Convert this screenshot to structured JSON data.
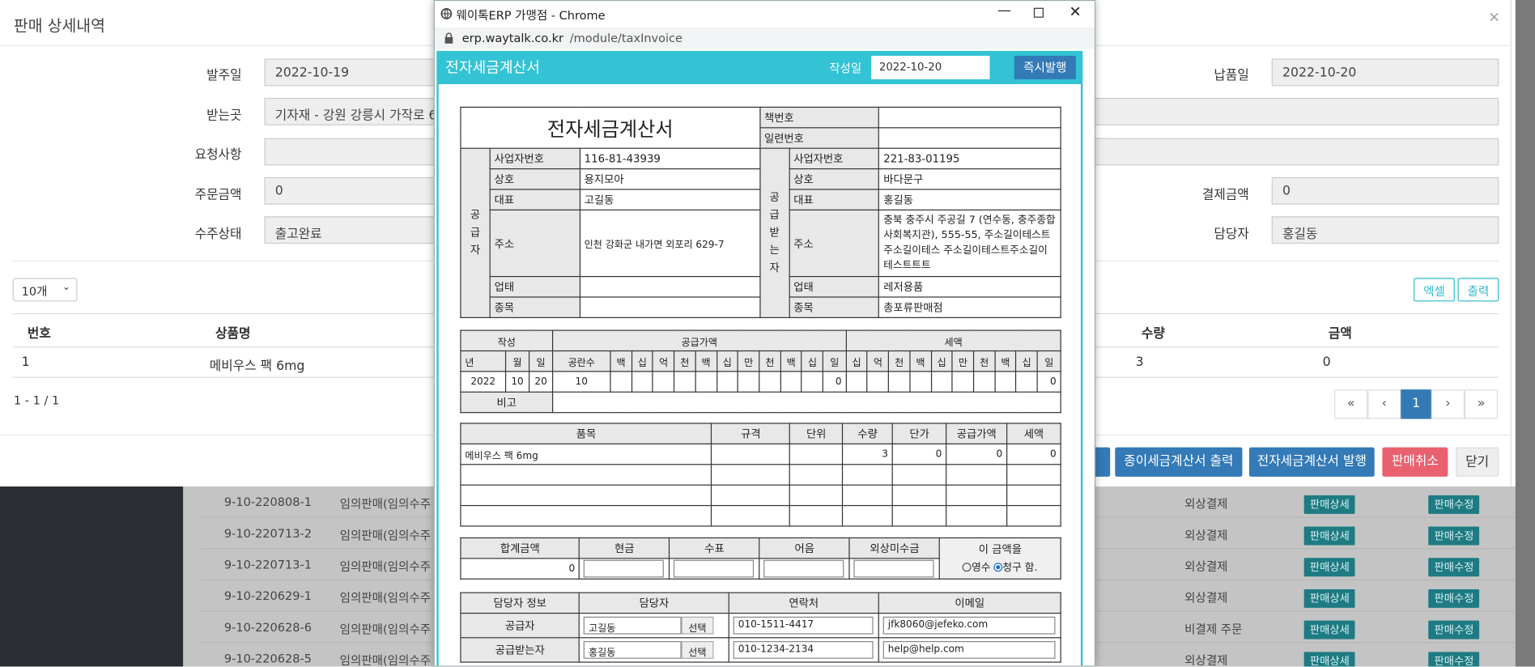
{
  "bg_rows": [
    {
      "id": "9-10-220808-1",
      "name": "임의판매(임의수주",
      "pay": "외상결제"
    },
    {
      "id": "9-10-220713-2",
      "name": "임의판매(임의수주",
      "pay": "외상결제"
    },
    {
      "id": "9-10-220713-1",
      "name": "임의판매(임의수주",
      "pay": "외상결제"
    },
    {
      "id": "9-10-220629-1",
      "name": "임의판매(임의수주",
      "pay": "외상결제"
    },
    {
      "id": "9-10-220628-6",
      "name": "임의판매(임의수주",
      "pay": "비결제 주문"
    },
    {
      "id": "9-10-220628-5",
      "name": "임의판매(임의수주",
      "pay": "외상결제"
    }
  ],
  "bg_btn_detail": "판매상세",
  "bg_btn_edit": "판매수정",
  "modal": {
    "title": "판매 상세내역",
    "close": "×",
    "order_date_label": "발주일",
    "order_date": "2022-10-19",
    "delivery_date_label": "납품일",
    "delivery_date": "2022-10-20",
    "ship_to_label": "받는곳",
    "ship_to": "기자재 - 강원 강릉시 가작로 6 (",
    "request_label": "요청사항",
    "order_amount_label": "주문금액",
    "order_amount": "0",
    "pay_amount_label": "결제금액",
    "pay_amount": "0",
    "status_label": "수주상태",
    "status": "출고완료",
    "manager_label": "담당자",
    "manager": "홍길동",
    "page_size": "10개",
    "excel": "엑셀",
    "print": "출력",
    "col_no": "번호",
    "col_product": "상품명",
    "col_qty": "수량",
    "col_amount": "금액",
    "row_no": "1",
    "row_product": "메비우스 팩 6mg",
    "row_qty": "3",
    "row_amount": "0",
    "range": "1 - 1 / 1",
    "pg_first": "«",
    "pg_prev": "‹",
    "pg_cur": "1",
    "pg_next": "›",
    "pg_last": "»",
    "btn_paper": "종이세금계산서 출력",
    "btn_e": "전자세금계산서 발행",
    "btn_cancel": "판매취소",
    "btn_close": "닫기"
  },
  "popup": {
    "window_title": "웨이톡ERP 가맹점 - Chrome",
    "url_host": "erp.waytalk.co.kr",
    "url_path": "/module/taxInvoice",
    "header_title": "전자세금계산서",
    "write_date_label": "작성일",
    "write_date": "2022-10-20",
    "issue_btn": "즉시발행",
    "doc_title": "전자세금계산서",
    "book_no": "책번호",
    "serial_no": "일련번호",
    "supplier": "공급자",
    "receiver": "공급받는자",
    "biz_no": "사업자번호",
    "trade_name": "상호",
    "ceo": "대표",
    "address": "주소",
    "biz_type": "업태",
    "biz_item": "종목",
    "s_biz_no": "116-81-43939",
    "s_name": "용지모아",
    "s_ceo": "고길동",
    "s_addr": "인천 강화군 내가면 외포리 629-7",
    "r_biz_no": "221-83-01195",
    "r_name": "바다문구",
    "r_ceo": "홍길동",
    "r_addr": "충북 충주시 주공길 7 (연수동, 충주종합사회복지관), 555-55, 주소길이테스트주소길이테스 주소길이테스트주소길이테스트트트",
    "r_type": "레저용품",
    "r_item": "총포류판매점",
    "write": "작성",
    "supply_value": "공급가액",
    "tax": "세액",
    "year": "년",
    "month": "월",
    "day": "일",
    "blank_count": "공란수",
    "digits_supply": [
      "백",
      "십",
      "억",
      "천",
      "백",
      "십",
      "만",
      "천",
      "백",
      "십",
      "일"
    ],
    "digits_tax": [
      "십",
      "억",
      "천",
      "백",
      "십",
      "만",
      "천",
      "백",
      "십",
      "일"
    ],
    "v_year": "2022",
    "v_month": "10",
    "v_day": "20",
    "v_blank": "10",
    "v_supply_last": "0",
    "v_tax_last": "0",
    "note": "비고",
    "item_h": "품목",
    "spec_h": "규격",
    "unit_h": "단위",
    "qty_h": "수량",
    "price_h": "단가",
    "supply_h": "공급가액",
    "tax_h": "세액",
    "item": "메비우스 팩 6mg",
    "item_qty": "3",
    "item_price": "0",
    "item_supply": "0",
    "item_tax": "0",
    "total_h": "합계금액",
    "cash_h": "현금",
    "check_h": "수표",
    "bill_h": "어음",
    "credit_h": "외상미수금",
    "total": "0",
    "this_amount": "이 금액을",
    "receipt": "영수",
    "claim": "청구 함.",
    "contact_h": "담당자 정보",
    "person_h": "담당자",
    "phone_h": "연락처",
    "email_h": "이메일",
    "sup_row": "공급자",
    "rec_row": "공급받는자",
    "select": "선택",
    "sup_person": "고길동",
    "sup_phone": "010-1511-4417",
    "sup_email": "jfk8060@jefeko.com",
    "rec_person": "홍길동",
    "rec_phone": "010-1234-2134",
    "rec_email": "help@help.com"
  },
  "colors": {
    "accent": "#33c3d4",
    "primary": "#337ab7",
    "danger": "#e9616f"
  }
}
